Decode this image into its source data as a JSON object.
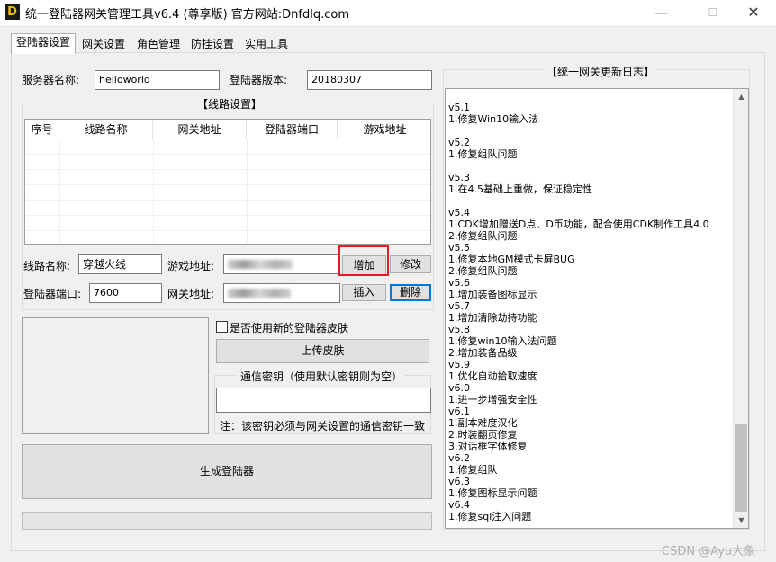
{
  "window": {
    "icon_letter": "D",
    "title": "统一登陆器网关管理工具v6.4 (尊享版)  官方网站:Dnfdlq.com",
    "min_glyph": "—",
    "max_glyph": "☐",
    "close_glyph": "✕"
  },
  "tabs": [
    {
      "label": "登陆器设置",
      "active": true
    },
    {
      "label": "网关设置"
    },
    {
      "label": "角色管理"
    },
    {
      "label": "防挂设置"
    },
    {
      "label": "实用工具"
    }
  ],
  "server": {
    "name_label": "服务器名称:",
    "name_value": "helloworld",
    "version_label": "登陆器版本:",
    "version_value": "20180307"
  },
  "route_settings": {
    "title": "【线路设置】",
    "columns": [
      "序号",
      "线路名称",
      "网关地址",
      "登陆器端口",
      "游戏地址"
    ],
    "route_name_label": "线路名称:",
    "route_name_value": "穿越火线",
    "game_addr_label": "游戏地址:",
    "port_label": "登陆器端口:",
    "port_value": "7600",
    "gateway_addr_label": "网关地址:",
    "add_button": "增加",
    "modify_button": "修改",
    "insert_button": "插入",
    "delete_button": "删除"
  },
  "skin": {
    "use_new_skin_label": "是否使用新的登陆器皮肤",
    "use_new_skin_checked": false,
    "upload_button": "上传皮肤",
    "key_title": "通信密钥（使用默认密钥则为空）",
    "key_value": "",
    "key_note": "注：该密钥必须与网关设置的通信密钥一致"
  },
  "generate_button": "生成登陆器",
  "progress_fraction": 0,
  "update_log": {
    "title": "【统一网关更新日志】",
    "text": "v5.1\n1.修复Win10输入法\n\nv5.2\n1.修复组队问题\n\nv5.3\n1.在4.5基础上重做，保证稳定性\n\nv5.4\n1.CDK增加赠送D点、D币功能，配合使用CDK制作工具4.0\n2.修复组队问题\nv5.5\n1.修复本地GM模式卡屏BUG\n2.修复组队问题\nv5.6\n1.增加装备图标显示\nv5.7\n1.增加清除劫持功能\nv5.8\n1.修复win10输入法问题\n2.增加装备品级\nv5.9\n1.优化自动拾取速度\nv6.0\n1.进一步增强安全性\nv6.1\n1.副本难度汉化\n2.时装翻页修复\n3.对话框字体修复\nv6.2\n1.修复组队\nv6.3\n1.修复图标显示问题\nv6.4\n1.修复sql注入问题"
  },
  "watermark": "CSDN @Ayu大象",
  "colors": {
    "highlight_box": "#e02020",
    "focus_border": "#0078d7",
    "progress_fill": "#06b025"
  }
}
